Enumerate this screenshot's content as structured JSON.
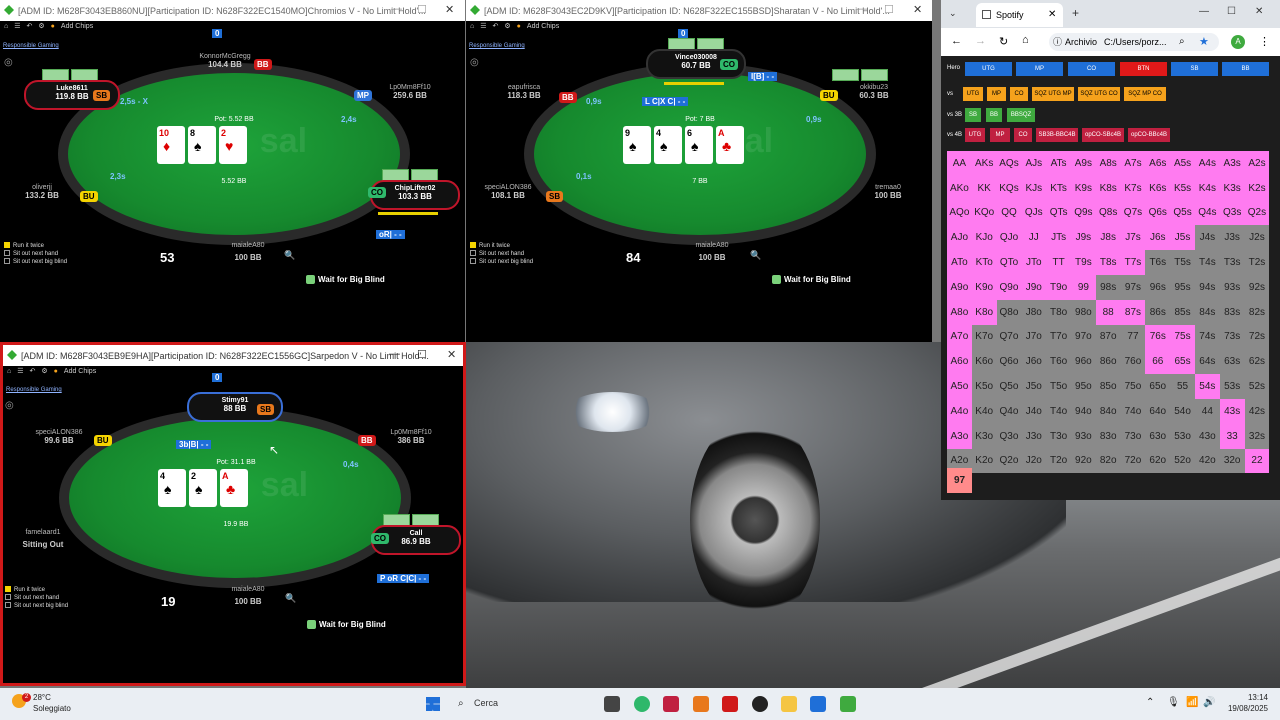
{
  "windows": [
    {
      "title": "[ADM ID: M628F3043EB860NU][Participation ID: N628F322EC1540MO]Chromios V - No Limit Hold'...",
      "toolbar": {
        "add_chips": "Add Chips"
      },
      "responsible": "Responsible Gaming",
      "pot_label": "Pot: 5.52 BB",
      "pot_chips": "5.52 BB",
      "board": [
        {
          "rank": "10",
          "suit": "♦",
          "red": true
        },
        {
          "rank": "8",
          "suit": "♠",
          "red": false
        },
        {
          "rank": "2",
          "suit": "♥",
          "red": true
        }
      ],
      "top_counter": "0",
      "seats": [
        {
          "name": "KonnorMcGregg",
          "stack": "104.4 BB"
        },
        {
          "name": "Luke8611",
          "stack": "119.8 BB"
        },
        {
          "name": "Lp0Mm8Ff10",
          "stack": "259.6 BB"
        },
        {
          "name": "oliverjj",
          "stack": "133.2 BB"
        },
        {
          "name": "ChipLifter02",
          "stack": "103.3 BB"
        },
        {
          "name": "maialeA80",
          "stack": "100 BB"
        }
      ],
      "positions": {
        "bb": "BB",
        "sb": "SB",
        "mp": "MP",
        "bu": "BU",
        "co": "CO"
      },
      "timers": [
        "2,5s - X",
        "2,4s",
        "2,3s"
      ],
      "hl": "oR| - -",
      "options": [
        "Run it twice",
        "Sit out next hand",
        "Sit out next big blind"
      ],
      "hand_no": "53",
      "wait_bb": "Wait for Big Blind"
    },
    {
      "title": "[ADM ID: M628F3043EC2D9KV][Participation ID: N628F322EC155BSD]Sharatan V - No Limit Hold'...",
      "toolbar": {
        "add_chips": "Add Chips"
      },
      "responsible": "Responsible Gaming",
      "pot_label": "Pot: 7 BB",
      "pot_chips": "7 BB",
      "board": [
        {
          "rank": "9",
          "suit": "♠",
          "red": false
        },
        {
          "rank": "4",
          "suit": "♠",
          "red": false
        },
        {
          "rank": "6",
          "suit": "♠",
          "red": false
        },
        {
          "rank": "A",
          "suit": "♣",
          "red": true
        }
      ],
      "top_counter": "0",
      "seats": [
        {
          "name": "Vince030008",
          "stack": "60.7 BB"
        },
        {
          "name": "eapufrisca",
          "stack": "118.3 BB"
        },
        {
          "name": "okkibu23",
          "stack": "60.3 BB"
        },
        {
          "name": "speciALON386",
          "stack": "108.1 BB"
        },
        {
          "name": "tremaa0",
          "stack": "100 BB"
        },
        {
          "name": "maialeA80",
          "stack": "100 BB"
        }
      ],
      "positions": {
        "bb": "BB",
        "co": "CO",
        "bu": "BU",
        "sb": "SB"
      },
      "timers": [
        "0,9s",
        "0,9s",
        "0,1s"
      ],
      "hl_top": "I[B] - -",
      "hl_mid": "L C|X C| - -",
      "options": [
        "Run it twice",
        "Sit out next hand",
        "Sit out next big blind"
      ],
      "hand_no": "84",
      "wait_bb": "Wait for Big Blind"
    },
    {
      "title": "[ADM ID: M628F3043EB9E9HA][Participation ID: N628F322EC1556GC]Sarpedon V - No Limit Hold'...",
      "toolbar": {
        "add_chips": "Add Chips"
      },
      "responsible": "Responsible Gaming",
      "pot_label": "Pot: 31.1 BB",
      "pot_chips": "19.9 BB",
      "board": [
        {
          "rank": "4",
          "suit": "♠",
          "red": false
        },
        {
          "rank": "2",
          "suit": "♠",
          "red": false
        },
        {
          "rank": "A",
          "suit": "♣",
          "red": true
        }
      ],
      "top_counter": "0",
      "seats": [
        {
          "name": "Stimy91",
          "stack": "88 BB"
        },
        {
          "name": "speciALON386",
          "stack": "99.6 BB"
        },
        {
          "name": "Lp0Mm8Ff10",
          "stack": "386 BB"
        },
        {
          "name": "famelaard1",
          "stack": "Sitting Out"
        },
        {
          "name": "Call",
          "stack": "86.9 BB"
        },
        {
          "name": "maialeA80",
          "stack": "100 BB"
        }
      ],
      "positions": {
        "sb": "SB",
        "bu": "BU",
        "bb": "BB",
        "co": "CO"
      },
      "timers": [
        "0,4s"
      ],
      "hl_mid": "3b|B| - -",
      "hl": "P oR C|C| - -",
      "options": [
        "Run it twice",
        "Sit out next hand",
        "Sit out next big blind"
      ],
      "hand_no": "19",
      "wait_bb": "Wait for Big Blind"
    }
  ],
  "spotify": {
    "tab_title": "Spotify",
    "url_prefix": "Archivio",
    "url": "C:/Users/porz...",
    "avatar": "A",
    "rows": [
      {
        "label": "Hero",
        "buttons": [
          "UTG",
          "MP",
          "CO",
          "BTN",
          "SB",
          "BB"
        ]
      },
      {
        "label": "vs",
        "buttons": [
          "UTG",
          "MP",
          "CO",
          "SQZ UTG MP",
          "SQZ UTG CO",
          "SQZ MP CO"
        ]
      },
      {
        "label": "vs 3B",
        "buttons": [
          "SB",
          "BB",
          "BBSQZ"
        ]
      },
      {
        "label": "vs 4B",
        "buttons": [
          "UTG",
          "MP",
          "CO",
          "SB3B-BBC4B",
          "opCO-SBc4B",
          "opCO-BBc4B"
        ]
      }
    ],
    "grid": [
      [
        "AA",
        "AKs",
        "AQs",
        "AJs",
        "ATs",
        "A9s",
        "A8s",
        "A7s",
        "A6s",
        "A5s",
        "A4s",
        "A3s",
        "A2s"
      ],
      [
        "AKo",
        "KK",
        "KQs",
        "KJs",
        "KTs",
        "K9s",
        "K8s",
        "K7s",
        "K6s",
        "K5s",
        "K4s",
        "K3s",
        "K2s"
      ],
      [
        "AQo",
        "KQo",
        "QQ",
        "QJs",
        "QTs",
        "Q9s",
        "Q8s",
        "Q7s",
        "Q6s",
        "Q5s",
        "Q4s",
        "Q3s",
        "Q2s"
      ],
      [
        "AJo",
        "KJo",
        "QJo",
        "JJ",
        "JTs",
        "J9s",
        "J8s",
        "J7s",
        "J6s",
        "J5s",
        "J4s",
        "J3s",
        "J2s"
      ],
      [
        "ATo",
        "KTo",
        "QTo",
        "JTo",
        "TT",
        "T9s",
        "T8s",
        "T7s",
        "T6s",
        "T5s",
        "T4s",
        "T3s",
        "T2s"
      ],
      [
        "A9o",
        "K9o",
        "Q9o",
        "J9o",
        "T9o",
        "99",
        "98s",
        "97s",
        "96s",
        "95s",
        "94s",
        "93s",
        "92s"
      ],
      [
        "A8o",
        "K8o",
        "Q8o",
        "J8o",
        "T8o",
        "98o",
        "88",
        "87s",
        "86s",
        "85s",
        "84s",
        "83s",
        "82s"
      ],
      [
        "A7o",
        "K7o",
        "Q7o",
        "J7o",
        "T7o",
        "97o",
        "87o",
        "77",
        "76s",
        "75s",
        "74s",
        "73s",
        "72s"
      ],
      [
        "A6o",
        "K6o",
        "Q6o",
        "J6o",
        "T6o",
        "96o",
        "86o",
        "76o",
        "66",
        "65s",
        "64s",
        "63s",
        "62s"
      ],
      [
        "A5o",
        "K5o",
        "Q5o",
        "J5o",
        "T5o",
        "95o",
        "85o",
        "75o",
        "65o",
        "55",
        "54s",
        "53s",
        "52s"
      ],
      [
        "A4o",
        "K4o",
        "Q4o",
        "J4o",
        "T4o",
        "94o",
        "84o",
        "74o",
        "64o",
        "54o",
        "44",
        "43s",
        "42s"
      ],
      [
        "A3o",
        "K3o",
        "Q3o",
        "J3o",
        "T3o",
        "93o",
        "83o",
        "73o",
        "63o",
        "53o",
        "43o",
        "33",
        "32s"
      ],
      [
        "A2o",
        "K2o",
        "Q2o",
        "J2o",
        "T2o",
        "92o",
        "82o",
        "72o",
        "62o",
        "52o",
        "42o",
        "32o",
        "22"
      ]
    ],
    "grid_colors": [
      "ppppppppppppp",
      "ppppppppppppp",
      "ppppppppppppp",
      "ppppppppppggg",
      "ppppppppggggg",
      "ppppppggggggg",
      "ppggggppggggg",
      "pgggggggppggg",
      "pgggggggppggg",
      "pgggggggggpgg",
      "pggggggggggpg",
      "pggggggggggpg",
      "ggggggggggggp"
    ],
    "combo_count": "97"
  },
  "taskbar": {
    "temp": "28°C",
    "weather": "Soleggiato",
    "badge": "2",
    "search": "Cerca",
    "time": "13:14",
    "date": "19/08/2025"
  },
  "colors": {
    "felt": "#168a2e",
    "accent_blue": "#1f6fd8",
    "range_pink": "#ff7bf0"
  }
}
